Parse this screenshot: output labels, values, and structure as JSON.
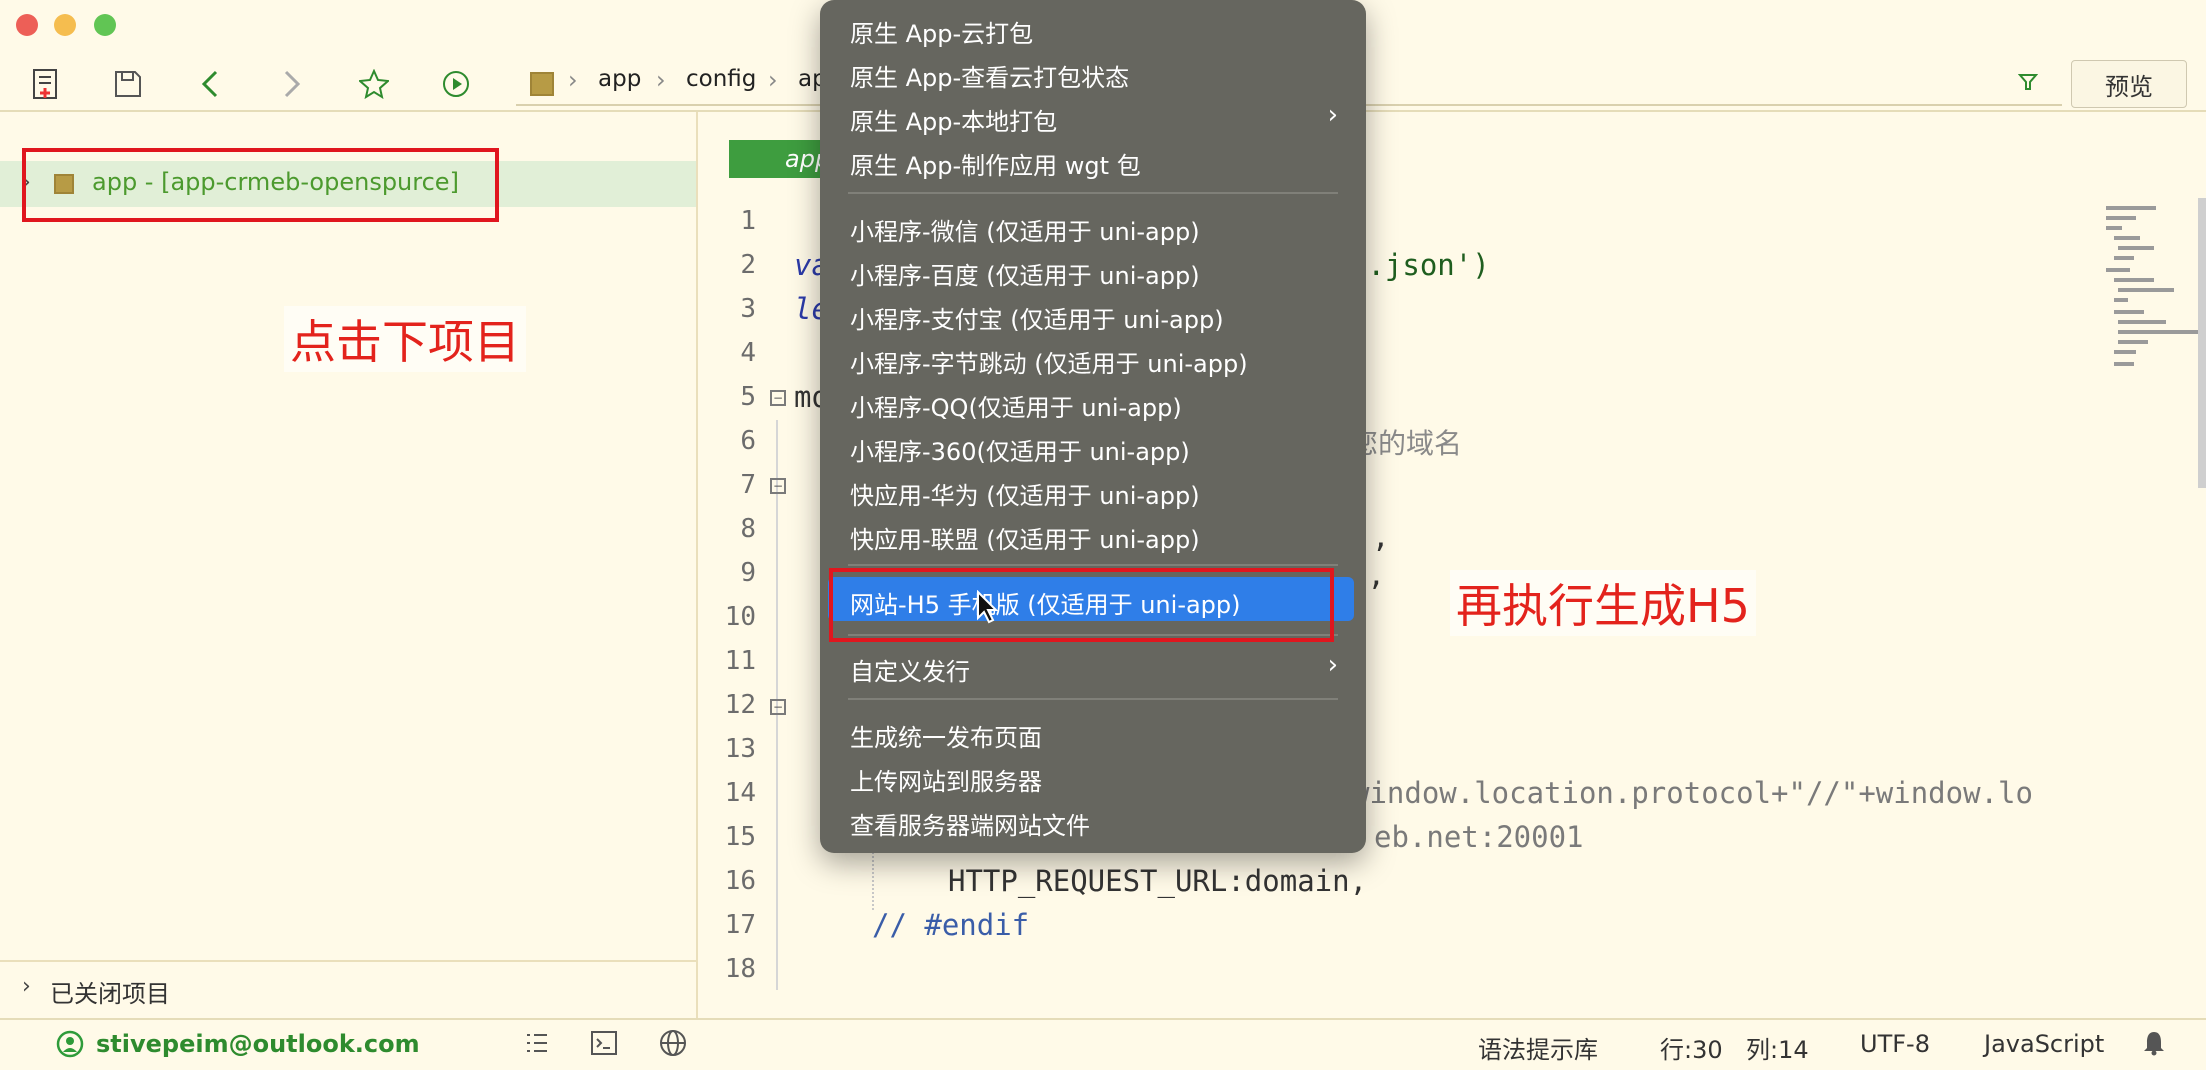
{
  "toolbar": {
    "breadcrumb": [
      "app",
      "config",
      "ap"
    ],
    "preview_label": "预览"
  },
  "sidebar": {
    "project_label": "app - [app-crmeb-openspurce]",
    "annotation_click": "点击下项目",
    "closed_projects_label": "已关闭项目"
  },
  "editor": {
    "tab_label": "app",
    "lines": [
      {
        "n": "1",
        "text": ""
      },
      {
        "n": "2",
        "text": "va"
      },
      {
        "n": "3",
        "text": "le"
      },
      {
        "n": "4",
        "text": ""
      },
      {
        "n": "5",
        "text": "mo"
      },
      {
        "n": "6",
        "text": ""
      },
      {
        "n": "7",
        "text": ""
      },
      {
        "n": "8",
        "text": ""
      },
      {
        "n": "9",
        "text": ""
      },
      {
        "n": "10",
        "text": ""
      },
      {
        "n": "11",
        "text": ""
      },
      {
        "n": "12",
        "text": ""
      },
      {
        "n": "13",
        "text": ""
      },
      {
        "n": "14",
        "text": ""
      },
      {
        "n": "15",
        "text": ""
      },
      {
        "n": "16",
        "text": "HTTP_REQUEST_URL:domain,"
      },
      {
        "n": "17",
        "text": "// #endif"
      },
      {
        "n": "18",
        "text": ""
      }
    ],
    "right_fragments": {
      "l2": "n.json')",
      "l6": "您的域名",
      "l8": ",",
      "l9": "n,",
      "l14": "window.location.protocol+\"//\"+window.lo",
      "l15": "eb.net:20001"
    },
    "annotation_h5": "再执行生成H5"
  },
  "menu": {
    "items": [
      {
        "label": "原生 App-云打包"
      },
      {
        "label": "原生 App-查看云打包状态"
      },
      {
        "label": "原生 App-本地打包"
      },
      {
        "label": "原生 App-制作应用 wgt 包"
      },
      {
        "label": "小程序-微信 (仅适用于 uni-app)"
      },
      {
        "label": "小程序-百度 (仅适用于 uni-app)"
      },
      {
        "label": "小程序-支付宝 (仅适用于 uni-app)"
      },
      {
        "label": "小程序-字节跳动 (仅适用于 uni-app)"
      },
      {
        "label": "小程序-QQ(仅适用于 uni-app)"
      },
      {
        "label": "小程序-360(仅适用于 uni-app)"
      },
      {
        "label": "快应用-华为 (仅适用于 uni-app)"
      },
      {
        "label": "快应用-联盟 (仅适用于 uni-app)"
      },
      {
        "label": "网站-H5 手机版 (仅适用于 uni-app)"
      },
      {
        "label": "自定义发行"
      },
      {
        "label": "生成统一发布页面"
      },
      {
        "label": "上传网站到服务器"
      },
      {
        "label": "查看服务器端网站文件"
      }
    ]
  },
  "statusbar": {
    "account": "stivepeim@outlook.com",
    "syntax_lib": "语法提示库",
    "row": "行:30",
    "col": "列:14",
    "encoding": "UTF-8",
    "language": "JavaScript"
  }
}
